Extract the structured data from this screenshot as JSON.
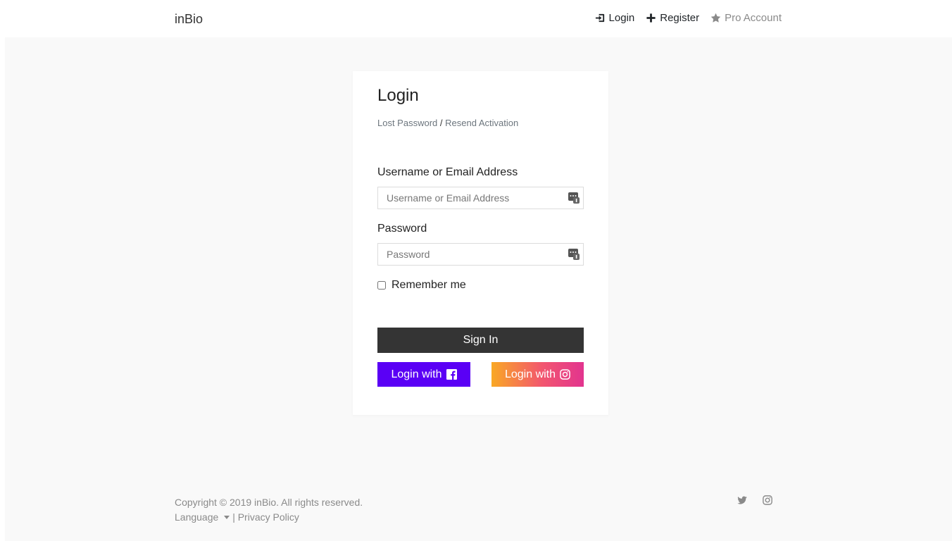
{
  "brand": "inBio",
  "nav": {
    "login": "Login",
    "register": "Register",
    "pro": "Pro Account"
  },
  "login_card": {
    "title": "Login",
    "lost_password": "Lost Password",
    "separator": "/",
    "resend_activation": "Resend Activation",
    "username_label": "Username or Email Address",
    "username_placeholder": "Username or Email Address",
    "password_label": "Password",
    "password_placeholder": "Password",
    "remember_label": "Remember me",
    "signin_label": "Sign In",
    "facebook_label": "Login with",
    "instagram_label": "Login with"
  },
  "footer": {
    "copyright": "Copyright © 2019 inBio. All rights reserved.",
    "language": "Language",
    "divider": "|",
    "privacy": "Privacy Policy"
  },
  "colors": {
    "signin_bg": "#343434",
    "facebook_bg": "#5a00f5",
    "instagram_gradient": [
      "#f9a824",
      "#e2348f"
    ],
    "page_bg": "#f9f9f9"
  }
}
